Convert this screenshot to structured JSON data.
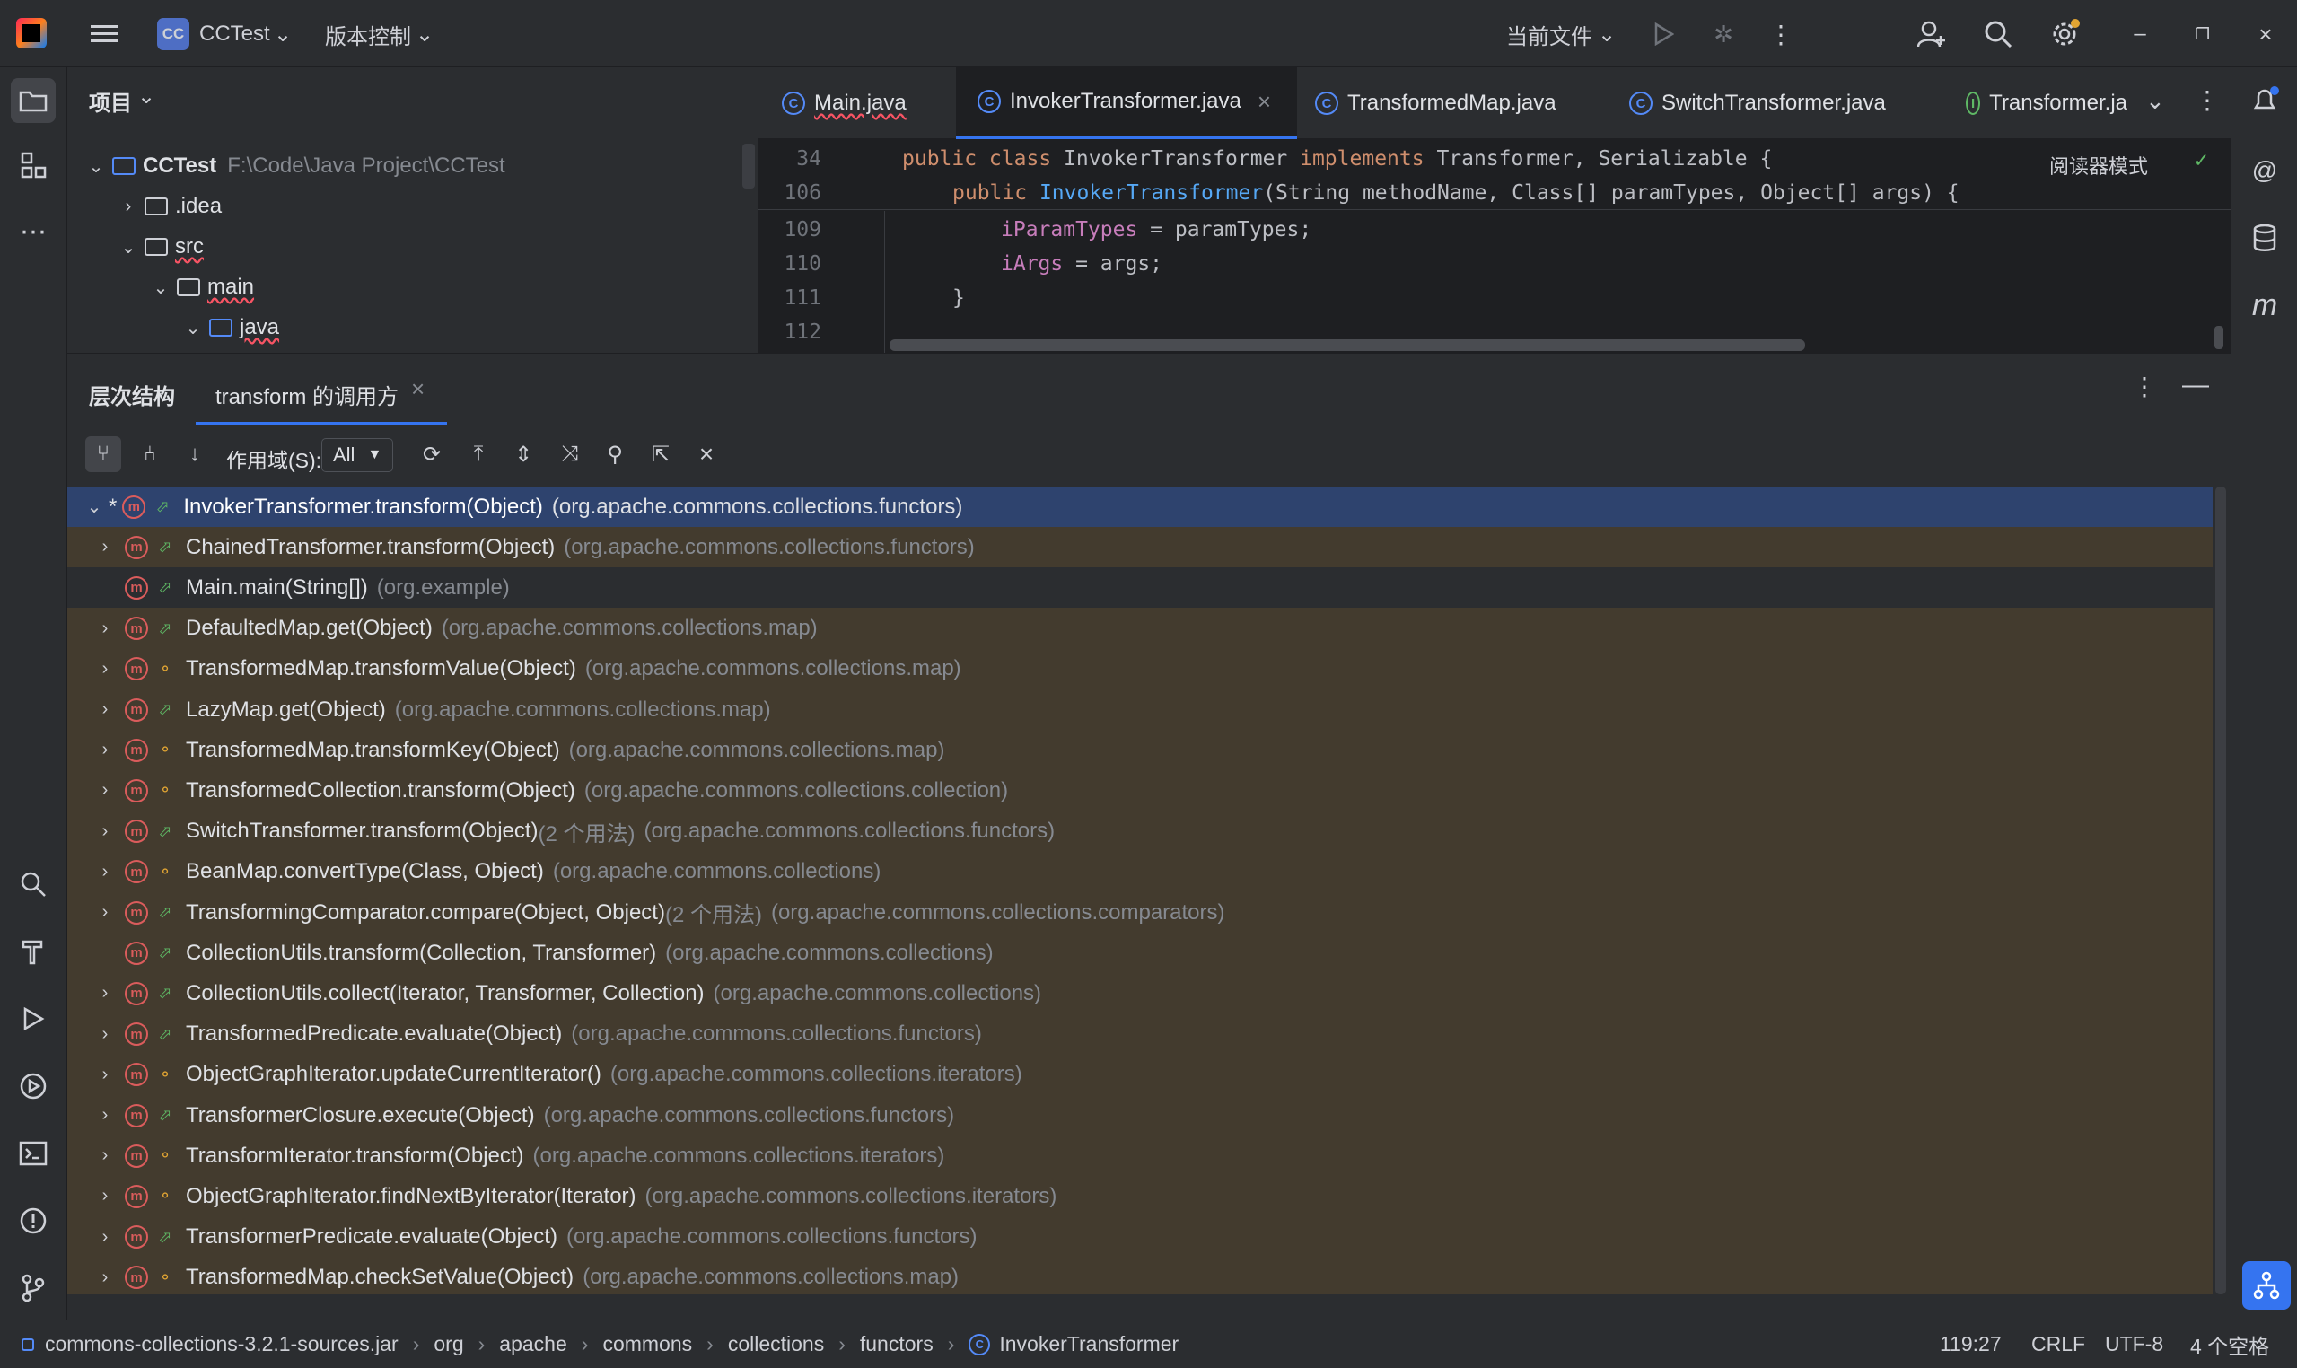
{
  "titlebar": {
    "project_badge": "CC",
    "project_name": "CCTest",
    "vcs_menu": "版本控制",
    "run_config": "当前文件"
  },
  "project_panel": {
    "title": "项目",
    "tree": [
      {
        "name": "CCTest",
        "path": "F:\\Code\\Java Project\\CCTest"
      },
      {
        "name": ".idea"
      },
      {
        "name": "src"
      },
      {
        "name": "main"
      },
      {
        "name": "java"
      }
    ]
  },
  "editor": {
    "tabs": [
      {
        "label": "Main.java",
        "icon": "class-icon"
      },
      {
        "label": "InvokerTransformer.java",
        "icon": "class-icon",
        "close": "×"
      },
      {
        "label": "TransformedMap.java",
        "icon": "class-icon"
      },
      {
        "label": "SwitchTransformer.java",
        "icon": "class-icon"
      },
      {
        "label": "Transformer.ja",
        "icon": "interface-icon"
      }
    ],
    "reader_mode": "阅读器模式",
    "sticky_lines": [
      {
        "ln": "34",
        "kw1": "public class ",
        "name": "InvokerTransformer",
        "kw2": " implements ",
        "rest": "Transformer, Serializable {"
      },
      {
        "ln": "106",
        "kw1": "public ",
        "fn": "InvokerTransformer",
        "rest": "(String methodName, Class[] paramTypes, Object[] args) {"
      }
    ],
    "lines": [
      {
        "ln": "109",
        "field": "iParamTypes",
        "rest": " = paramTypes;"
      },
      {
        "ln": "110",
        "field": "iArgs",
        "rest": " = args;"
      },
      {
        "ln": "111",
        "rest": "}"
      },
      {
        "ln": "112",
        "rest": ""
      }
    ]
  },
  "hierarchy": {
    "tab_structure": "层次结构",
    "tab_callers": "transform 的调用方",
    "tab_close": "×",
    "scope_label": "作用域(S):",
    "scope_value": "All",
    "rows": [
      {
        "method": "InvokerTransformer.transform(Object)",
        "uses": "",
        "pkg": "(org.apache.commons.collections.functors)",
        "expandable": true,
        "expanded": true,
        "root": true
      },
      {
        "method": "ChainedTransformer.transform(Object)",
        "uses": "",
        "pkg": "(org.apache.commons.collections.functors)",
        "expandable": true
      },
      {
        "method": "Main.main(String[])",
        "uses": "",
        "pkg": "(org.example)",
        "expandable": false
      },
      {
        "method": "DefaultedMap.get(Object)",
        "uses": "",
        "pkg": "(org.apache.commons.collections.map)",
        "expandable": true
      },
      {
        "method": "TransformedMap.transformValue(Object)",
        "uses": "",
        "pkg": "(org.apache.commons.collections.map)",
        "expandable": true,
        "protected": true
      },
      {
        "method": "LazyMap.get(Object)",
        "uses": "",
        "pkg": "(org.apache.commons.collections.map)",
        "expandable": true
      },
      {
        "method": "TransformedMap.transformKey(Object)",
        "uses": "",
        "pkg": "(org.apache.commons.collections.map)",
        "expandable": true,
        "protected": true
      },
      {
        "method": "TransformedCollection.transform(Object)",
        "uses": "",
        "pkg": "(org.apache.commons.collections.collection)",
        "expandable": true,
        "protected": true
      },
      {
        "method": "SwitchTransformer.transform(Object)",
        "uses": "(2 个用法)",
        "pkg": "(org.apache.commons.collections.functors)",
        "expandable": true
      },
      {
        "method": "BeanMap.convertType(Class, Object)",
        "uses": "",
        "pkg": "(org.apache.commons.collections)",
        "expandable": true,
        "protected": true
      },
      {
        "method": "TransformingComparator.compare(Object, Object)",
        "uses": "(2 个用法)",
        "pkg": "(org.apache.commons.collections.comparators)",
        "expandable": true
      },
      {
        "method": "CollectionUtils.transform(Collection, Transformer)",
        "uses": "",
        "pkg": "(org.apache.commons.collections)",
        "expandable": false
      },
      {
        "method": "CollectionUtils.collect(Iterator, Transformer, Collection)",
        "uses": "",
        "pkg": "(org.apache.commons.collections)",
        "expandable": true
      },
      {
        "method": "TransformedPredicate.evaluate(Object)",
        "uses": "",
        "pkg": "(org.apache.commons.collections.functors)",
        "expandable": true
      },
      {
        "method": "ObjectGraphIterator.updateCurrentIterator()",
        "uses": "",
        "pkg": "(org.apache.commons.collections.iterators)",
        "expandable": true,
        "protected": true
      },
      {
        "method": "TransformerClosure.execute(Object)",
        "uses": "",
        "pkg": "(org.apache.commons.collections.functors)",
        "expandable": true
      },
      {
        "method": "TransformIterator.transform(Object)",
        "uses": "",
        "pkg": "(org.apache.commons.collections.iterators)",
        "expandable": true,
        "protected": true
      },
      {
        "method": "ObjectGraphIterator.findNextByIterator(Iterator)",
        "uses": "",
        "pkg": "(org.apache.commons.collections.iterators)",
        "expandable": true,
        "protected": true
      },
      {
        "method": "TransformerPredicate.evaluate(Object)",
        "uses": "",
        "pkg": "(org.apache.commons.collections.functors)",
        "expandable": true
      },
      {
        "method": "TransformedMap.checkSetValue(Object)",
        "uses": "",
        "pkg": "(org.apache.commons.collections.map)",
        "expandable": true,
        "protected": true
      }
    ]
  },
  "statusbar": {
    "breadcrumbs": [
      "commons-collections-3.2.1-sources.jar",
      "org",
      "apache",
      "commons",
      "collections",
      "functors",
      "InvokerTransformer"
    ],
    "position": "119:27",
    "line_sep": "CRLF",
    "encoding": "UTF-8",
    "indent": "4 个空格"
  },
  "colors": {
    "accent": "#3574f0",
    "selection": "#2e436e",
    "caller_bg": "#433b2e",
    "method_icon": "#db5c5c"
  }
}
